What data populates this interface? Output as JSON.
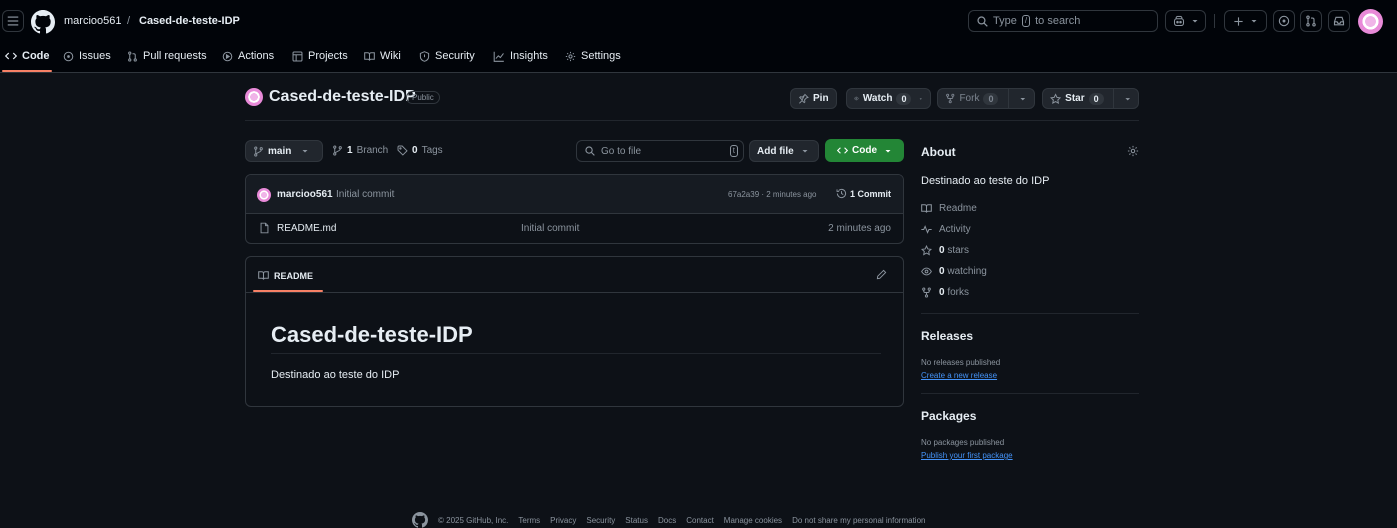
{
  "header": {
    "owner": "marcioo561",
    "slash": "/",
    "repo": "Cased-de-teste-IDP",
    "search_prefix": "Type",
    "search_key": "/",
    "search_suffix": "to search",
    "icons": [
      "hamburger-icon",
      "github-logo",
      "copilot-icon",
      "plus-icon",
      "issue-icon",
      "pull-request-icon",
      "inbox-icon",
      "user-avatar"
    ]
  },
  "nav": {
    "tabs": [
      {
        "label": "Code",
        "icon": "code-icon"
      },
      {
        "label": "Issues",
        "icon": "issue-icon"
      },
      {
        "label": "Pull requests",
        "icon": "pull-request-icon"
      },
      {
        "label": "Actions",
        "icon": "play-icon"
      },
      {
        "label": "Projects",
        "icon": "table-icon"
      },
      {
        "label": "Wiki",
        "icon": "book-icon"
      },
      {
        "label": "Security",
        "icon": "shield-icon"
      },
      {
        "label": "Insights",
        "icon": "graph-icon"
      },
      {
        "label": "Settings",
        "icon": "gear-icon"
      }
    ]
  },
  "repo": {
    "name": "Cased-de-teste-IDP",
    "visibility": "Public",
    "pin_label": "Pin",
    "watch_label": "Watch",
    "watch_count": "0",
    "fork_label": "Fork",
    "fork_count": "0",
    "star_label": "Star",
    "star_count": "0"
  },
  "toolbar": {
    "branch": "main",
    "branches_count": "1",
    "branches_label": "Branch",
    "tags_count": "0",
    "tags_label": "Tags",
    "goto_placeholder": "Go to file",
    "goto_key": "t",
    "addfile_label": "Add file",
    "code_label": "Code"
  },
  "commit": {
    "author": "marcioo561",
    "message": "Initial commit",
    "meta": "67a2a39 · 2 minutes ago",
    "count_label": "1 Commit"
  },
  "files": [
    {
      "name": "README.md",
      "message": "Initial commit",
      "time": "2 minutes ago"
    }
  ],
  "readme": {
    "tab_label": "README",
    "title": "Cased-de-teste-IDP",
    "body": "Destinado ao teste do IDP"
  },
  "about": {
    "heading": "About",
    "description": "Destinado ao teste do IDP",
    "readme": "Readme",
    "activity": "Activity",
    "stars_count": "0",
    "stars_label": "stars",
    "watching_count": "0",
    "watching_label": "watching",
    "forks_count": "0",
    "forks_label": "forks"
  },
  "releases": {
    "heading": "Releases",
    "note": "No releases published",
    "link": "Create a new release"
  },
  "packages": {
    "heading": "Packages",
    "note": "No packages published",
    "link": "Publish your first package"
  },
  "footer": {
    "copyright": "© 2025 GitHub, Inc.",
    "links": [
      "Terms",
      "Privacy",
      "Security",
      "Status",
      "Docs",
      "Contact",
      "Manage cookies",
      "Do not share my personal information"
    ]
  },
  "colors": {
    "bg": "#0d1117",
    "header_bg": "#010409",
    "border": "#30363d",
    "green": "#238636",
    "accent_underline": "#f78166",
    "link": "#4493f8"
  }
}
